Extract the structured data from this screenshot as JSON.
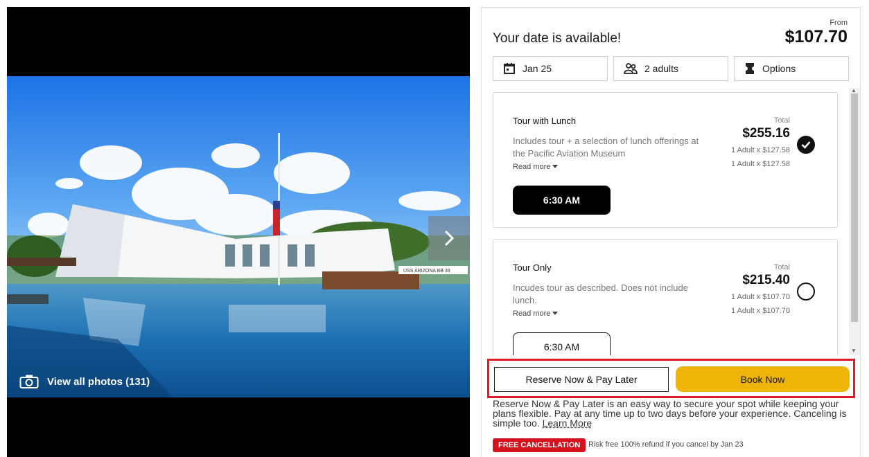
{
  "gallery": {
    "view_photos_label": "View all photos (131)",
    "next_icon": "chevron-right-icon",
    "camera_icon": "camera-icon",
    "sign_text": "USS ARIZONA BB 39"
  },
  "availability": {
    "title": "Your date is available!",
    "from_label": "From",
    "from_price": "$107.70"
  },
  "filters": {
    "date": {
      "label": "Jan 25",
      "icon": "calendar-icon"
    },
    "travelers": {
      "label": "2 adults",
      "icon": "people-icon"
    },
    "options": {
      "label": "Options",
      "icon": "ticket-icon"
    }
  },
  "options": [
    {
      "name": "Tour with Lunch",
      "description": "Includes tour + a selection of lunch offerings at the Pacific Aviation Museum",
      "read_more": "Read more",
      "total_label": "Total",
      "total_price": "$255.16",
      "breakdown": [
        "1 Adult x $127.58",
        "1 Adult x $127.58"
      ],
      "time": "6:30 AM",
      "selected": true
    },
    {
      "name": "Tour Only",
      "description": "Incudes tour as described. Does not include lunch.",
      "read_more": "Read more",
      "total_label": "Total",
      "total_price": "$215.40",
      "breakdown": [
        "1 Adult x $107.70",
        "1 Adult x $107.70"
      ],
      "time": "6:30 AM",
      "selected": false
    }
  ],
  "actions": {
    "reserve_label": "Reserve Now & Pay Later",
    "book_label": "Book Now"
  },
  "info": {
    "text": "Reserve Now & Pay Later is an easy way to secure your spot while keeping your plans flexible. Pay at any time up to two days before your experience. Canceling is simple too.",
    "learn_more": "Learn More"
  },
  "cancellation": {
    "badge": "FREE CANCELLATION",
    "text": "Risk free 100% refund if you cancel by Jan 23"
  },
  "colors": {
    "accent_yellow": "#eeb508",
    "highlight_red": "#e01d27",
    "badge_red": "#d5121e"
  }
}
